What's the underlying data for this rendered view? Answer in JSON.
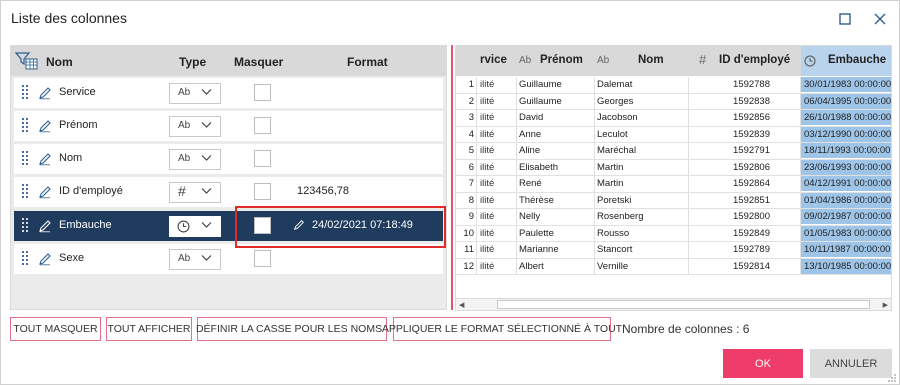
{
  "window": {
    "title": "Liste des colonnes"
  },
  "left_panel": {
    "headers": {
      "name": "Nom",
      "type": "Type",
      "hide": "Masquer",
      "format": "Format"
    },
    "rows": [
      {
        "name": "Service",
        "type_glyph": "Ab",
        "format": "",
        "selected": false
      },
      {
        "name": "Prénom",
        "type_glyph": "Ab",
        "format": "",
        "selected": false
      },
      {
        "name": "Nom",
        "type_glyph": "Ab",
        "format": "",
        "selected": false
      },
      {
        "name": "ID d'employé",
        "type_glyph": "#",
        "format": "123456,78",
        "selected": false
      },
      {
        "name": "Embauche",
        "type_glyph": "clock",
        "format": "24/02/2021 07:18:49",
        "selected": true
      },
      {
        "name": "Sexe",
        "type_glyph": "Ab",
        "format": "",
        "selected": false
      }
    ]
  },
  "grid": {
    "headers": {
      "service": "rvice",
      "prenom_icon": "Ab",
      "prenom": "Prénom",
      "nom_icon": "Ab",
      "nom": "Nom",
      "id_icon": "#",
      "id": "ID d'employé",
      "embauche": "Embauche"
    },
    "rows": [
      {
        "n": "1",
        "svc": "ilité",
        "prenom": "Guillaume",
        "nom": "Dalemat",
        "id": "1592788",
        "emb": "30/01/1983 00:00:00"
      },
      {
        "n": "2",
        "svc": "ilité",
        "prenom": "Guillaume",
        "nom": "Georges",
        "id": "1592838",
        "emb": "06/04/1995 00:00:00"
      },
      {
        "n": "3",
        "svc": "ilité",
        "prenom": "David",
        "nom": "Jacobson",
        "id": "1592856",
        "emb": "26/10/1988 00:00:00"
      },
      {
        "n": "4",
        "svc": "ilité",
        "prenom": "Anne",
        "nom": "Leculot",
        "id": "1592839",
        "emb": "03/12/1990 00:00:00"
      },
      {
        "n": "5",
        "svc": "ilité",
        "prenom": "Aline",
        "nom": "Maréchal",
        "id": "1592791",
        "emb": "18/11/1993 00:00:00"
      },
      {
        "n": "6",
        "svc": "ilité",
        "prenom": "Elisabeth",
        "nom": "Martin",
        "id": "1592806",
        "emb": "23/06/1993 00:00:00"
      },
      {
        "n": "7",
        "svc": "ilité",
        "prenom": "René",
        "nom": "Martin",
        "id": "1592864",
        "emb": "04/12/1991 00:00:00"
      },
      {
        "n": "8",
        "svc": "ilité",
        "prenom": "Thérèse",
        "nom": "Poretski",
        "id": "1592851",
        "emb": "01/04/1986 00:00:00"
      },
      {
        "n": "9",
        "svc": "ilité",
        "prenom": "Nelly",
        "nom": "Rosenberg",
        "id": "1592800",
        "emb": "09/02/1987 00:00:00"
      },
      {
        "n": "10",
        "svc": "ilité",
        "prenom": "Paulette",
        "nom": "Rousso",
        "id": "1592849",
        "emb": "01/05/1983 00:00:00"
      },
      {
        "n": "11",
        "svc": "ilité",
        "prenom": "Marianne",
        "nom": "Stancort",
        "id": "1592789",
        "emb": "10/11/1987 00:00:00"
      },
      {
        "n": "12",
        "svc": "ilité",
        "prenom": "Albert",
        "nom": "Vernille",
        "id": "1592814",
        "emb": "13/10/1985 00:00:00"
      }
    ]
  },
  "actions": {
    "hide_all": "TOUT MASQUER",
    "show_all": "TOUT AFFICHER",
    "define_case": "DÉFINIR LA CASSE POUR LES NOMS",
    "apply_format": "APPLIQUER LE FORMAT SÉLECTIONNÉ À TOUT",
    "column_count": "Nombre de colonnes : 6"
  },
  "footer": {
    "ok": "OK",
    "cancel": "ANNULER"
  },
  "colors": {
    "accent": "#ee3d6a",
    "selection": "#1f3c5e",
    "highlight_column": "#9ec4e8",
    "annotation": "#e02b2b"
  }
}
